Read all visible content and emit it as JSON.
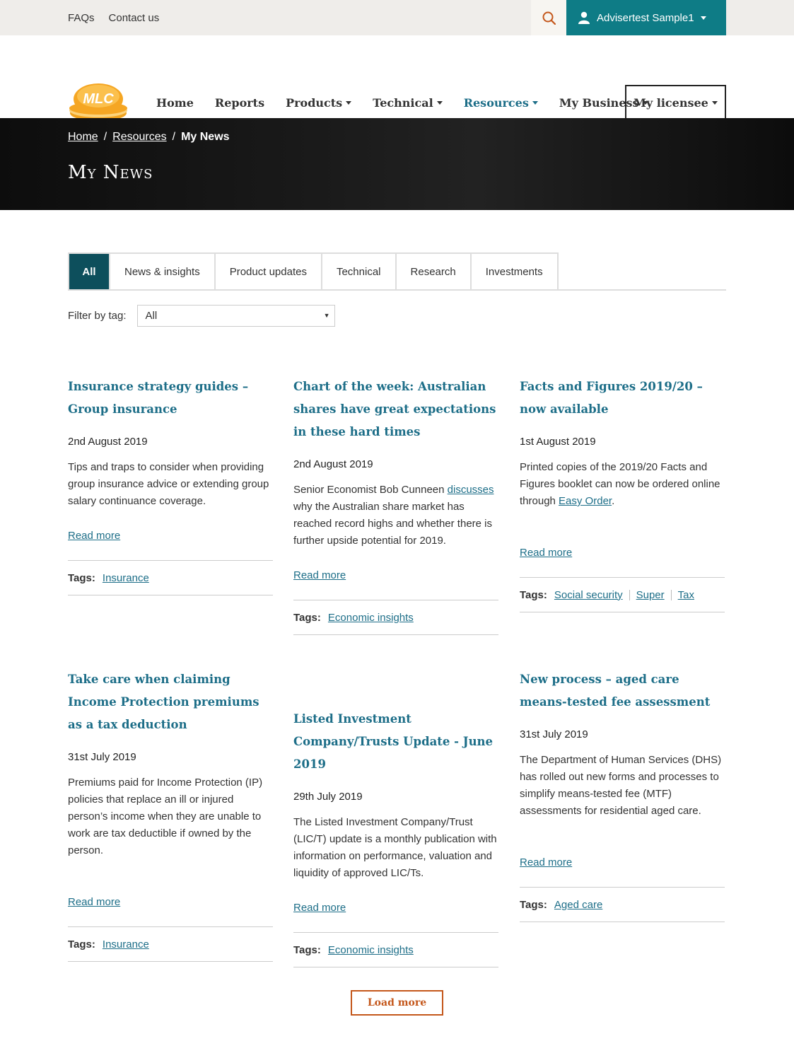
{
  "topbar": {
    "links": [
      "FAQs",
      "Contact us"
    ],
    "user_name": "Advisertest Sample1",
    "search_icon": "search-icon",
    "user_icon": "user-icon"
  },
  "nav": {
    "logo_text": "MLC",
    "items": [
      {
        "label": "Home",
        "dropdown": false
      },
      {
        "label": "Reports",
        "dropdown": false
      },
      {
        "label": "Products",
        "dropdown": true
      },
      {
        "label": "Technical",
        "dropdown": true
      },
      {
        "label": "Resources",
        "dropdown": true
      },
      {
        "label": "My Business",
        "dropdown": true
      }
    ],
    "licensee": "My licensee"
  },
  "breadcrumb": {
    "home": "Home",
    "resources": "Resources",
    "current": "My News",
    "separator": "/"
  },
  "page_title": "My News",
  "tabs": [
    "All",
    "News & insights",
    "Product updates",
    "Technical",
    "Research",
    "Investments"
  ],
  "filter": {
    "label": "Filter by tag:",
    "value": "All"
  },
  "cards": [
    {
      "title": "Insurance strategy guides – Group insurance",
      "date": "2nd August 2019",
      "desc_before": "Tips and traps to consider when providing group insurance advice or extending group salary continuance coverage.",
      "link": "",
      "desc_after": "",
      "read_more": "Read more",
      "tags_label": "Tags:",
      "tags": [
        "Insurance"
      ]
    },
    {
      "title": "Chart of the week: Australian shares have great expectations in these hard times",
      "date": "2nd August 2019",
      "desc_before": "Senior Economist Bob Cunneen ",
      "link": "discusses",
      "desc_after": " why the Australian share market has reached record highs and whether there is further upside potential for 2019.",
      "read_more": "Read more",
      "tags_label": "Tags:",
      "tags": [
        "Economic insights"
      ]
    },
    {
      "title": "Facts and Figures 2019/20 – now available",
      "date": "1st August 2019",
      "desc_before": "Printed copies of the 2019/20 Facts and Figures booklet can now be ordered online through ",
      "link": "Easy Order",
      "desc_after": ".",
      "read_more": "Read more",
      "tags_label": "Tags:",
      "tags": [
        "Social security",
        "Super",
        "Tax"
      ]
    },
    {
      "title": "Take care when claiming Income Protection premiums as a tax deduction",
      "date": "31st July 2019",
      "desc_before": "Premiums paid for Income Protection (IP) policies that replace an ill or injured person’s income when they are unable to work are tax deductible if owned by the person.",
      "link": "",
      "desc_after": "",
      "read_more": "Read more",
      "tags_label": "Tags:",
      "tags": [
        "Insurance"
      ]
    },
    {
      "title": "Listed Investment Company/Trusts Update - June 2019",
      "date": "29th July 2019",
      "desc_before": "The Listed Investment Company/Trust (LIC/T) update is a monthly publication with information on performance, valuation and liquidity of approved LIC/Ts.",
      "link": "",
      "desc_after": "",
      "read_more": "Read more",
      "tags_label": "Tags:",
      "tags": [
        "Economic insights"
      ]
    },
    {
      "title": "New process – aged care means-tested fee assessment",
      "date": "31st July 2019",
      "desc_before": "The Department of Human Services (DHS) has rolled out new forms and processes to simplify means-tested fee (MTF) assessments for residential aged care.",
      "link": "",
      "desc_after": "",
      "read_more": "Read more",
      "tags_label": "Tags:",
      "tags": [
        "Aged care"
      ]
    }
  ],
  "load_more": "Load more",
  "colors": {
    "teal": "#0e7c86",
    "link": "#1d6e88",
    "tab_active": "#0d4f5c",
    "orange": "#c4571b",
    "logo": "#f5a623"
  }
}
